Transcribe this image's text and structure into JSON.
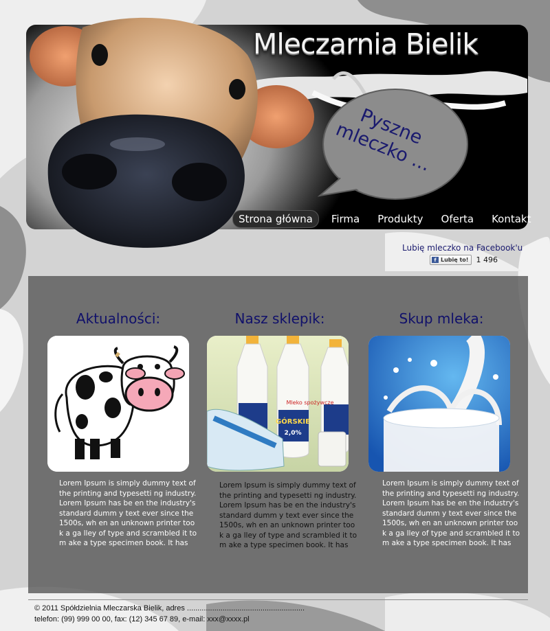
{
  "header": {
    "site_title": "Mleczarnia Bielik",
    "bubble_text": "Pyszne mleczko ...",
    "nav": [
      {
        "label": "Strona główna",
        "active": true
      },
      {
        "label": "Firma",
        "active": false
      },
      {
        "label": "Produkty",
        "active": false
      },
      {
        "label": "Oferta",
        "active": false
      },
      {
        "label": "Kontakt",
        "active": false
      }
    ]
  },
  "facebook": {
    "caption": "Lubię mleczko na Facebook'u",
    "button_label": "Lubię to!",
    "count": "1 496"
  },
  "columns": [
    {
      "title": "Aktualności:",
      "image": "cartoon-cow-icon",
      "text": "Lorem Ipsum is simply dummy text of the printing and typesetti ng industry. Lorem Ipsum has be en the industry's standard dumm y text ever since the 1500s, wh en an unknown printer took a ga lley of type and scrambled it to m ake a type specimen book. It has"
    },
    {
      "title": "Nasz sklepik:",
      "image": "milk-bottles-icon",
      "bottle_label": "GÓRSKIE",
      "bottle_fat": "2,0%",
      "bottle_brand": "Mleko spożywcze",
      "text": "Lorem Ipsum is simply dummy text of the printing and typesetti ng industry. Lorem Ipsum has be en the industry's standard dumm y text ever since the 1500s, wh en an unknown printer took a ga lley of type and scrambled it to m ake a type specimen book. It has"
    },
    {
      "title": "Skup mleka:",
      "image": "milk-splash-glass-icon",
      "text": "Lorem Ipsum is simply dummy text of the printing and typesetti ng industry. Lorem Ipsum has be en the industry's standard dumm y text ever since the 1500s, wh en an unknown printer took a ga lley of type and scrambled it to m ake a type specimen book. It has"
    }
  ],
  "footer": {
    "line1": "© 2011 Spółdzielnia Mleczarska Bielik, adres ........................................................",
    "line2": "telefon: (99) 999 00 00, fax: (12) 345 67 89, e-mail: xxx@xxxx.pl"
  },
  "colors": {
    "title_navy": "#10106a",
    "panel_gray": "#5a5a5a",
    "header_black": "#000000"
  }
}
